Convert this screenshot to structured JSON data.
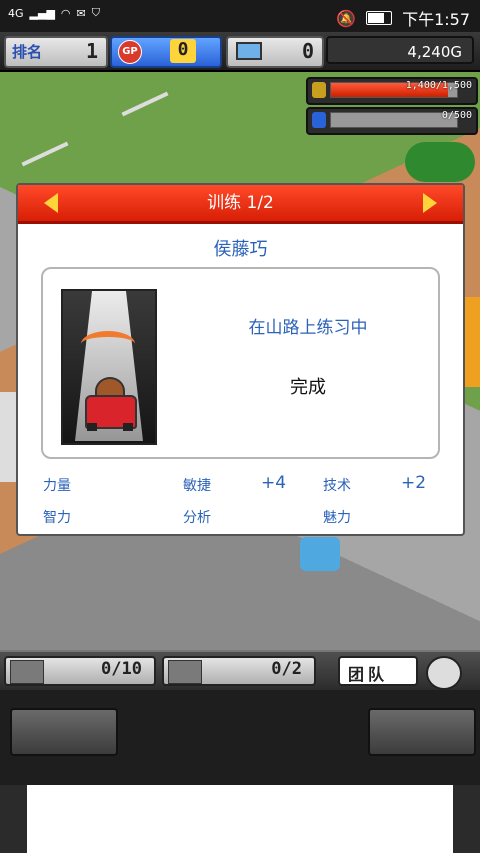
{
  "status_bar": {
    "network": "4G",
    "time": "下午1:57"
  },
  "hud": {
    "rank_label": "排名",
    "rank_value": "1",
    "gp_coin": "GP",
    "gp_value": "0",
    "pc_value": "0",
    "money": "4,240G"
  },
  "resources": [
    {
      "icon": "coin-stack-icon",
      "text": "1,400/1,500",
      "fill_fraction": 0.93,
      "color": "#e03a1a"
    },
    {
      "icon": "fuel-icon",
      "text": "0/500",
      "fill_fraction": 0,
      "color": "#2a62d8"
    }
  ],
  "dialog": {
    "title": "训练 1/2",
    "character_name": "侯藤巧",
    "status": "在山路上练习中",
    "result": "完成",
    "stats": {
      "power_label": "力量",
      "agility_label": "敏捷",
      "agility_value": "+4",
      "technique_label": "技术",
      "technique_value": "+2",
      "intellect_label": "智力",
      "analysis_label": "分析",
      "charm_label": "魅力"
    }
  },
  "bottom_bar": {
    "items_count": "0/10",
    "cars_count": "0/2",
    "team_label": "团队"
  }
}
